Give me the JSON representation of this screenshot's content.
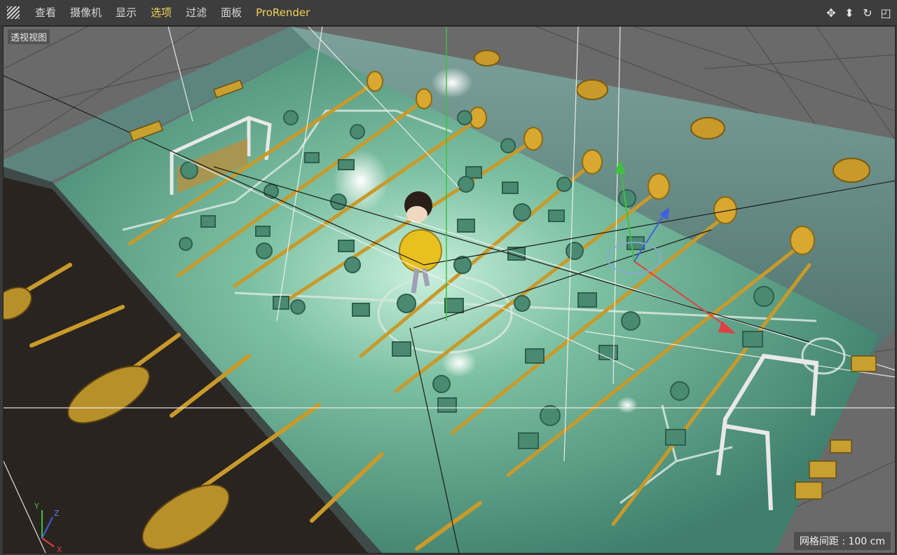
{
  "menu": {
    "items": [
      {
        "label": "查看"
      },
      {
        "label": "摄像机"
      },
      {
        "label": "显示"
      },
      {
        "label": "选项"
      },
      {
        "label": "过滤"
      },
      {
        "label": "面板"
      },
      {
        "label": "ProRender"
      }
    ]
  },
  "toolbar_icons": [
    "move-icon",
    "pan-icon",
    "rotate-icon",
    "maximize-icon"
  ],
  "viewport": {
    "label": "透视视图",
    "grid_label": "网格间距 : 100 cm",
    "axes": {
      "x": "X",
      "y": "Y",
      "z": "Z"
    }
  },
  "colors": {
    "accent": "#f2d25a",
    "field": "#5fa88a",
    "rod": "#c89a2a",
    "player": "#4a8a72",
    "axis_x": "#e04040",
    "axis_y": "#40c040",
    "axis_z": "#4060e0"
  }
}
